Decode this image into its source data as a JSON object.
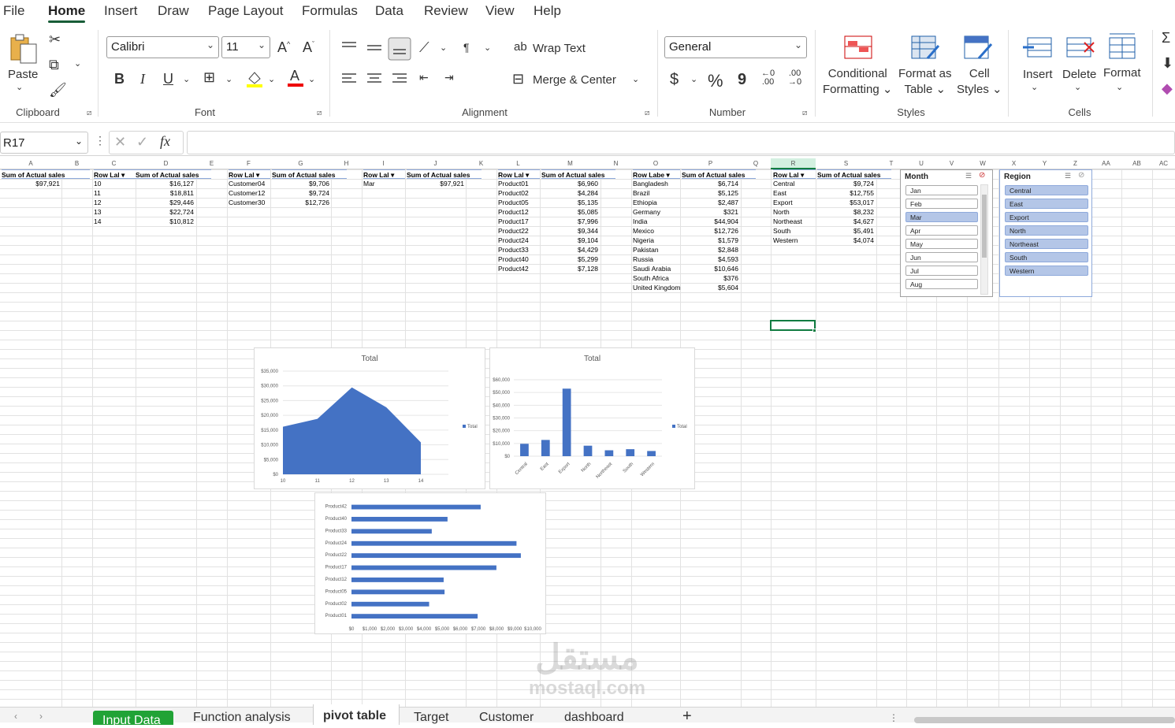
{
  "menu": {
    "items": [
      "File",
      "Home",
      "Insert",
      "Draw",
      "Page Layout",
      "Formulas",
      "Data",
      "Review",
      "View",
      "Help"
    ]
  },
  "ribbon": {
    "clipboard": {
      "paste": "Paste",
      "label": "Clipboard"
    },
    "font": {
      "name": "Calibri",
      "size": "11",
      "label": "Font",
      "bold": "B",
      "italic": "I",
      "underline": "U"
    },
    "alignment": {
      "wrap": "Wrap Text",
      "merge": "Merge & Center",
      "label": "Alignment"
    },
    "number": {
      "format": "General",
      "label": "Number",
      "currency": "$",
      "percent": "%",
      "comma": "9"
    },
    "styles": {
      "cond1": "Conditional",
      "cond2": "Formatting",
      "fmt1": "Format as",
      "fmt2": "Table",
      "cell1": "Cell",
      "cell2": "Styles",
      "label": "Styles"
    },
    "cells": {
      "insert": "Insert",
      "delete": "Delete",
      "format": "Format",
      "label": "Cells"
    }
  },
  "formula_bar": {
    "name_box": "R17",
    "fx": "fx",
    "value": ""
  },
  "columns": [
    "A",
    "B",
    "C",
    "D",
    "E",
    "F",
    "G",
    "H",
    "I",
    "J",
    "K",
    "L",
    "M",
    "N",
    "O",
    "P",
    "Q",
    "R",
    "S",
    "T",
    "U",
    "V",
    "W",
    "X",
    "Y",
    "Z",
    "AA",
    "AB",
    "AC"
  ],
  "pivots": {
    "p1": {
      "h1": "Sum of Actual sales",
      "rows": [
        [
          "",
          "$97,921"
        ]
      ]
    },
    "p2": {
      "h1": "Row Lal",
      "h2": "Sum of Actual sales",
      "rows": [
        [
          "10",
          "$16,127"
        ],
        [
          "11",
          "$18,811"
        ],
        [
          "12",
          "$29,446"
        ],
        [
          "13",
          "$22,724"
        ],
        [
          "14",
          "$10,812"
        ]
      ]
    },
    "p3": {
      "h1": "Row Lal",
      "h2": "Sum of Actual sales",
      "rows": [
        [
          "Customer04",
          "$9,706"
        ],
        [
          "Customer12",
          "$9,724"
        ],
        [
          "Customer30",
          "$12,726"
        ]
      ]
    },
    "p4": {
      "h1": "Row Lal",
      "h2": "Sum of Actual sales",
      "rows": [
        [
          "Mar",
          "$97,921"
        ]
      ]
    },
    "p5": {
      "h1": "Row Lal",
      "h2": "Sum of Actual sales",
      "rows": [
        [
          "Product01",
          "$6,960"
        ],
        [
          "Product02",
          "$4,284"
        ],
        [
          "Product05",
          "$5,135"
        ],
        [
          "Product12",
          "$5,085"
        ],
        [
          "Product17",
          "$7,996"
        ],
        [
          "Product22",
          "$9,344"
        ],
        [
          "Product24",
          "$9,104"
        ],
        [
          "Product33",
          "$4,429"
        ],
        [
          "Product40",
          "$5,299"
        ],
        [
          "Product42",
          "$7,128"
        ]
      ]
    },
    "p6": {
      "h1": "Row Labe",
      "h2": "Sum of Actual sales",
      "rows": [
        [
          "Bangladesh",
          "$6,714"
        ],
        [
          "Brazil",
          "$5,125"
        ],
        [
          "Ethiopia",
          "$2,487"
        ],
        [
          "Germany",
          "$321"
        ],
        [
          "India",
          "$44,904"
        ],
        [
          "Mexico",
          "$12,726"
        ],
        [
          "Nigeria",
          "$1,579"
        ],
        [
          "Pakistan",
          "$2,848"
        ],
        [
          "Russia",
          "$4,593"
        ],
        [
          "Saudi Arabia",
          "$10,646"
        ],
        [
          "South Africa",
          "$376"
        ],
        [
          "United Kingdom",
          "$5,604"
        ]
      ]
    },
    "p7": {
      "h1": "Row Lal",
      "h2": "Sum of Actual sales",
      "rows": [
        [
          "Central",
          "$9,724"
        ],
        [
          "East",
          "$12,755"
        ],
        [
          "Export",
          "$53,017"
        ],
        [
          "North",
          "$8,232"
        ],
        [
          "Northeast",
          "$4,627"
        ],
        [
          "South",
          "$5,491"
        ],
        [
          "Western",
          "$4,074"
        ]
      ]
    }
  },
  "slicers": {
    "month": {
      "title": "Month",
      "items": [
        "Jan",
        "Feb",
        "Mar",
        "Apr",
        "May",
        "Jun",
        "Jul",
        "Aug"
      ],
      "selected": "Mar"
    },
    "region": {
      "title": "Region",
      "items": [
        "Central",
        "East",
        "Export",
        "North",
        "Northeast",
        "South",
        "Western"
      ]
    }
  },
  "chart_data": [
    {
      "type": "area",
      "title": "Total",
      "legend": "Total",
      "x": [
        10,
        11,
        12,
        13,
        14
      ],
      "values": [
        16127,
        18811,
        29446,
        22724,
        10812
      ],
      "ylim": [
        0,
        35000
      ],
      "yticks": [
        "$0",
        "$5,000",
        "$10,000",
        "$15,000",
        "$20,000",
        "$25,000",
        "$30,000",
        "$35,000"
      ],
      "color": "#4472c4"
    },
    {
      "type": "bar",
      "title": "Total",
      "legend": "Total",
      "categories": [
        "Central",
        "East",
        "Export",
        "North",
        "Northeast",
        "South",
        "Western"
      ],
      "values": [
        9724,
        12755,
        53017,
        8232,
        4627,
        5491,
        4074
      ],
      "ylim": [
        0,
        60000
      ],
      "yticks": [
        "$0",
        "$10,000",
        "$20,000",
        "$30,000",
        "$40,000",
        "$50,000",
        "$60,000"
      ],
      "color": "#4472c4"
    },
    {
      "type": "bar",
      "orientation": "horizontal",
      "categories": [
        "Product01",
        "Product02",
        "Product05",
        "Product12",
        "Product17",
        "Product22",
        "Product24",
        "Product33",
        "Product40",
        "Product42"
      ],
      "values": [
        6960,
        4284,
        5135,
        5085,
        7996,
        9344,
        9104,
        4429,
        5299,
        7128
      ],
      "xlim": [
        0,
        10000
      ],
      "xticks": [
        "$0",
        "$1,000",
        "$2,000",
        "$3,000",
        "$4,000",
        "$5,000",
        "$6,000",
        "$7,000",
        "$8,000",
        "$9,000",
        "$10,000"
      ],
      "color": "#4472c4"
    }
  ],
  "sheet_tabs": [
    "Input Data",
    "Function analysis",
    "pivot table",
    "Target",
    "Customer",
    "dashboard"
  ],
  "watermark": "mostaql.com"
}
